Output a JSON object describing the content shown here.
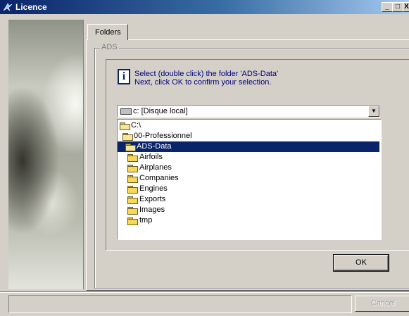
{
  "window": {
    "title": "Licence",
    "min_label": "_",
    "max_label": "□",
    "close_label": "X"
  },
  "tabs": [
    {
      "label": "Folders"
    }
  ],
  "group": {
    "label": "ADS"
  },
  "info": {
    "icon_glyph": "i",
    "line1": "Select (double click) the folder 'ADS-Data'",
    "line2": "Next, click OK to confirm your selection."
  },
  "drive_combo": {
    "value": "c: [Disque local]",
    "arrow": "▼"
  },
  "tree": {
    "items": [
      {
        "label": "C:\\"
      },
      {
        "label": "00-Professionnel"
      },
      {
        "label": "ADS-Data"
      },
      {
        "label": "Airfoils"
      },
      {
        "label": "Airplanes"
      },
      {
        "label": "Companies"
      },
      {
        "label": "Engines"
      },
      {
        "label": "Exports"
      },
      {
        "label": "Images"
      },
      {
        "label": "tmp"
      }
    ],
    "selected": "ADS-Data"
  },
  "buttons": {
    "ok": "OK",
    "cancel": "Cancel"
  }
}
